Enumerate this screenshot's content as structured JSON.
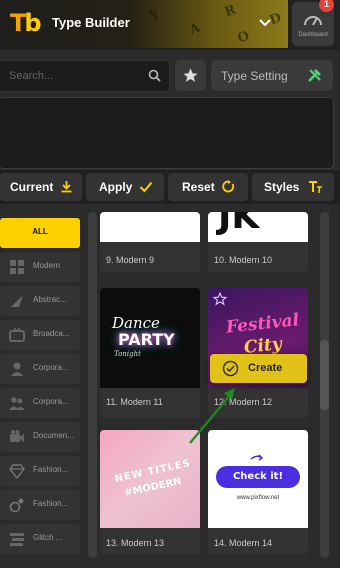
{
  "header": {
    "logo_t": "T",
    "logo_b": "b",
    "title": "Type Builder",
    "dashboard_label": "Dashboard",
    "badge_count": "1"
  },
  "toolbar": {
    "search_placeholder": "Search...",
    "type_setting_label": "Type Setting"
  },
  "actions": {
    "current_label": "Current",
    "apply_label": "Apply",
    "reset_label": "Reset",
    "styles_label": "Styles"
  },
  "sidebar": {
    "items": [
      {
        "label": "ALL",
        "icon": "all"
      },
      {
        "label": "Modern",
        "icon": "grid-icon"
      },
      {
        "label": "Abstrac...",
        "icon": "abstract-icon"
      },
      {
        "label": "Broadca...",
        "icon": "tv-icon"
      },
      {
        "label": "Corpora...",
        "icon": "person-icon"
      },
      {
        "label": "Corpora...",
        "icon": "people-icon"
      },
      {
        "label": "Documen...",
        "icon": "camera-icon"
      },
      {
        "label": "Fashion...",
        "icon": "diamond-icon"
      },
      {
        "label": "Fashion...",
        "icon": "ring-icon"
      },
      {
        "label": "Glitch ...",
        "icon": "glitch-icon"
      }
    ]
  },
  "cards": [
    {
      "name": "9. Modern 9",
      "thumb_text": ""
    },
    {
      "name": "10. Modern 10",
      "thumb_text": "JK"
    },
    {
      "name": "11. Modern 11",
      "thumb_text": "Dance",
      "thumb_text2": "PARTY",
      "thumb_text3": "Tonight"
    },
    {
      "name": "12. Modern 12",
      "thumb_text": "Festival",
      "thumb_text2": "City"
    },
    {
      "name": "13. Modern 13",
      "thumb_text": "NEW TITLES",
      "thumb_text2": "#MODERN"
    },
    {
      "name": "14. Modern 14",
      "thumb_text": "Check it!",
      "thumb_text2": "www.pixflow.net"
    }
  ],
  "create_label": "Create",
  "colors": {
    "accent": "#ffd000",
    "create": "#e2c218",
    "badge": "#e8433b",
    "arrow": "#1f8a1f"
  }
}
